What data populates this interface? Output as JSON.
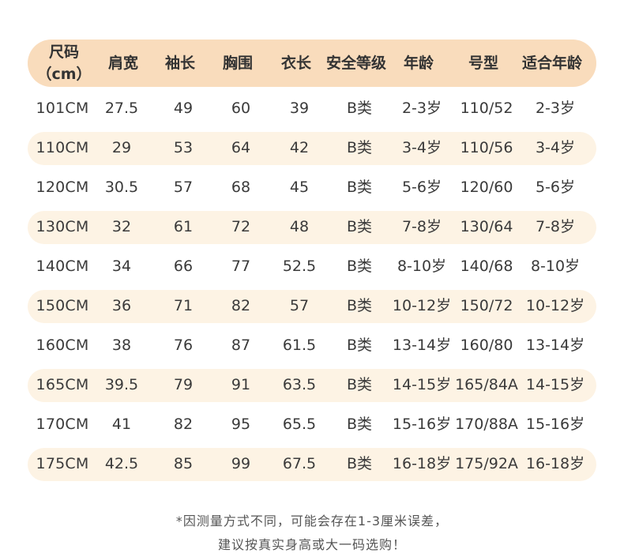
{
  "table": {
    "headers": [
      "尺码（cm）",
      "肩宽",
      "袖长",
      "胸围",
      "衣长",
      "安全等级",
      "年龄",
      "号型",
      "适合年龄"
    ],
    "rows": [
      [
        "101CM",
        "27.5",
        "49",
        "60",
        "39",
        "B类",
        "2-3岁",
        "110/52",
        "2-3岁"
      ],
      [
        "110CM",
        "29",
        "53",
        "64",
        "42",
        "B类",
        "3-4岁",
        "110/56",
        "3-4岁"
      ],
      [
        "120CM",
        "30.5",
        "57",
        "68",
        "45",
        "B类",
        "5-6岁",
        "120/60",
        "5-6岁"
      ],
      [
        "130CM",
        "32",
        "61",
        "72",
        "48",
        "B类",
        "7-8岁",
        "130/64",
        "7-8岁"
      ],
      [
        "140CM",
        "34",
        "66",
        "77",
        "52.5",
        "B类",
        "8-10岁",
        "140/68",
        "8-10岁"
      ],
      [
        "150CM",
        "36",
        "71",
        "82",
        "57",
        "B类",
        "10-12岁",
        "150/72",
        "10-12岁"
      ],
      [
        "160CM",
        "38",
        "76",
        "87",
        "61.5",
        "B类",
        "13-14岁",
        "160/80",
        "13-14岁"
      ],
      [
        "165CM",
        "39.5",
        "79",
        "91",
        "63.5",
        "B类",
        "14-15岁",
        "165/84A",
        "14-15岁"
      ],
      [
        "170CM",
        "41",
        "82",
        "95",
        "65.5",
        "B类",
        "15-16岁",
        "170/88A",
        "15-16岁"
      ],
      [
        "175CM",
        "42.5",
        "85",
        "99",
        "67.5",
        "B类",
        "16-18岁",
        "175/92A",
        "16-18岁"
      ]
    ]
  },
  "notes": {
    "line1": "*因测量方式不同，可能会存在1-3厘米误差，",
    "line2": "建议按真实身高或大一码选购！"
  },
  "colors": {
    "header_bg": "#f9dcbc",
    "stripe_bg": "#fdf3e4",
    "text": "#3a3a3a"
  }
}
